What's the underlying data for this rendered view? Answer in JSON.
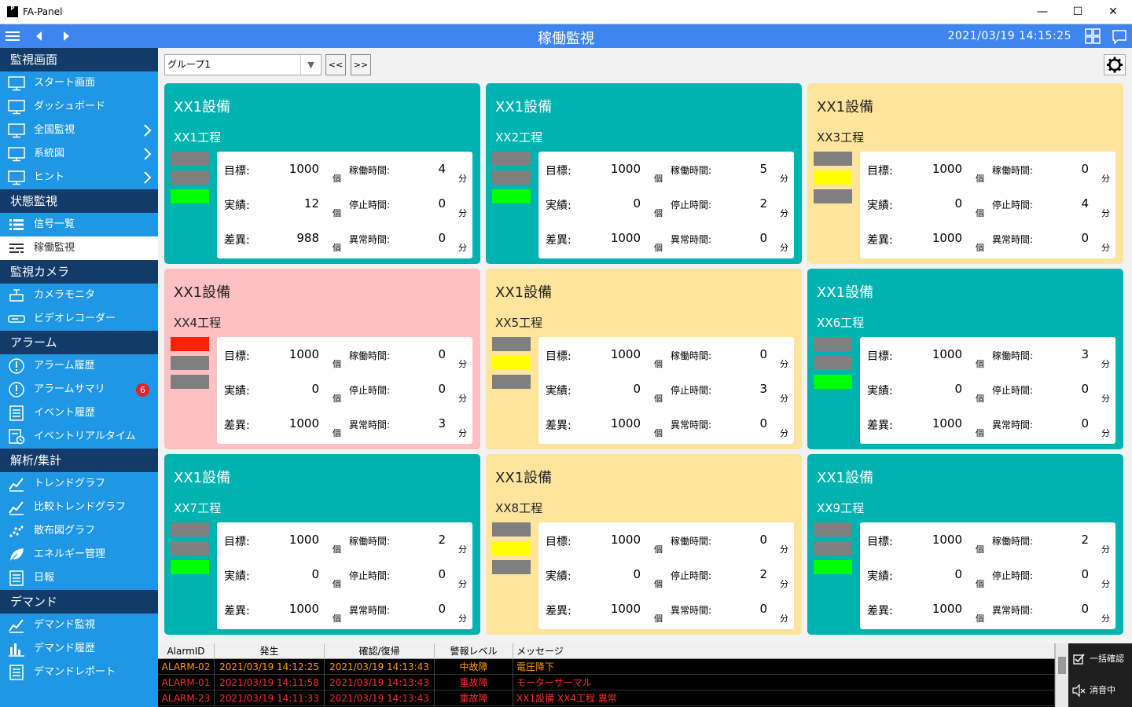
{
  "window": {
    "icon_text": "P",
    "title": "FA-Panel",
    "minimize": "—",
    "maximize": "☐",
    "close": "✕"
  },
  "header": {
    "title": "稼働監視",
    "datetime": "2021/03/19 14:15:25"
  },
  "sidebar": {
    "sections": [
      {
        "title": "監視画面",
        "items": [
          {
            "label": "スタート画面",
            "icon": "monitor-icon"
          },
          {
            "label": "ダッシュボード",
            "icon": "monitor-icon"
          },
          {
            "label": "全国監視",
            "icon": "monitor-icon",
            "chevron": true
          },
          {
            "label": "系統図",
            "icon": "monitor-icon",
            "chevron": true
          },
          {
            "label": "ヒント",
            "icon": "monitor-icon",
            "chevron": true
          }
        ]
      },
      {
        "title": "状態監視",
        "items": [
          {
            "label": "信号一覧",
            "icon": "list-icon"
          },
          {
            "label": "稼働監視",
            "icon": "gantt-icon",
            "active": true
          }
        ]
      },
      {
        "title": "監視カメラ",
        "items": [
          {
            "label": "カメラモニタ",
            "icon": "camera-icon"
          },
          {
            "label": "ビデオレコーダー",
            "icon": "recorder-icon"
          }
        ]
      },
      {
        "title": "アラーム",
        "items": [
          {
            "label": "アラーム履歴",
            "icon": "alert-icon"
          },
          {
            "label": "アラームサマリ",
            "icon": "alert-icon",
            "badge": "6"
          },
          {
            "label": "イベント履歴",
            "icon": "document-icon"
          },
          {
            "label": "イベントリアルタイム",
            "icon": "realtime-icon"
          }
        ]
      },
      {
        "title": "解析/集計",
        "items": [
          {
            "label": "トレンドグラフ",
            "icon": "trend-icon"
          },
          {
            "label": "比較トレンドグラフ",
            "icon": "trend-icon"
          },
          {
            "label": "散布図グラフ",
            "icon": "scatter-icon"
          },
          {
            "label": "エネルギー管理",
            "icon": "leaf-icon"
          },
          {
            "label": "日報",
            "icon": "document-icon"
          }
        ]
      },
      {
        "title": "デマンド",
        "items": [
          {
            "label": "デマンド監視",
            "icon": "trend-icon"
          },
          {
            "label": "デマンド履歴",
            "icon": "bars-icon"
          },
          {
            "label": "デマンドレポート",
            "icon": "document-icon"
          }
        ]
      }
    ]
  },
  "toolbar": {
    "group_value": "グループ1",
    "dropdown_arrow": "▼",
    "prev_label": "<<",
    "next_label": ">>"
  },
  "labels": {
    "target": "目標:",
    "actual": "実績:",
    "diff": "差異:",
    "run_time": "稼働時間:",
    "stop_time": "停止時間:",
    "error_time": "異常時間:",
    "unit_pcs": "個",
    "unit_min": "分"
  },
  "colors": {
    "green_card": "#00b2b0",
    "yellow_card": "#ffe49e",
    "red_card": "#fec0c2",
    "header_blue": "#3f85ef",
    "sidebar_blue": "#1f97e4",
    "sidebar_section": "#123b6a"
  },
  "cards": [
    {
      "equipment": "XX1設備",
      "process": "XX1工程",
      "state": "green",
      "lamps": [
        "gray",
        "gray",
        "green"
      ],
      "target": "1000",
      "actual": "12",
      "diff": "988",
      "run": "4",
      "stop": "0",
      "error": "0"
    },
    {
      "equipment": "XX1設備",
      "process": "XX2工程",
      "state": "green",
      "lamps": [
        "gray",
        "gray",
        "green"
      ],
      "target": "1000",
      "actual": "0",
      "diff": "1000",
      "run": "5",
      "stop": "2",
      "error": "0"
    },
    {
      "equipment": "XX1設備",
      "process": "XX3工程",
      "state": "yellow",
      "lamps": [
        "gray",
        "yellow",
        "gray"
      ],
      "target": "1000",
      "actual": "0",
      "diff": "1000",
      "run": "0",
      "stop": "4",
      "error": "0"
    },
    {
      "equipment": "XX1設備",
      "process": "XX4工程",
      "state": "red",
      "lamps": [
        "red",
        "gray",
        "gray"
      ],
      "target": "1000",
      "actual": "0",
      "diff": "1000",
      "run": "0",
      "stop": "0",
      "error": "3"
    },
    {
      "equipment": "XX1設備",
      "process": "XX5工程",
      "state": "yellow",
      "lamps": [
        "gray",
        "yellow",
        "gray"
      ],
      "target": "1000",
      "actual": "0",
      "diff": "1000",
      "run": "0",
      "stop": "3",
      "error": "0"
    },
    {
      "equipment": "XX1設備",
      "process": "XX6工程",
      "state": "green",
      "lamps": [
        "gray",
        "gray",
        "green"
      ],
      "target": "1000",
      "actual": "0",
      "diff": "1000",
      "run": "3",
      "stop": "0",
      "error": "0"
    },
    {
      "equipment": "XX1設備",
      "process": "XX7工程",
      "state": "green",
      "lamps": [
        "gray",
        "gray",
        "green"
      ],
      "target": "1000",
      "actual": "0",
      "diff": "1000",
      "run": "2",
      "stop": "0",
      "error": "0"
    },
    {
      "equipment": "XX1設備",
      "process": "XX8工程",
      "state": "yellow",
      "lamps": [
        "gray",
        "yellow",
        "gray"
      ],
      "target": "1000",
      "actual": "0",
      "diff": "1000",
      "run": "0",
      "stop": "2",
      "error": "0"
    },
    {
      "equipment": "XX1設備",
      "process": "XX9工程",
      "state": "green",
      "lamps": [
        "gray",
        "gray",
        "green"
      ],
      "target": "1000",
      "actual": "0",
      "diff": "1000",
      "run": "2",
      "stop": "0",
      "error": "0"
    }
  ],
  "alarms": {
    "columns": [
      "AlarmID",
      "発生",
      "確認/復帰",
      "警報レベル",
      "メッセージ"
    ],
    "rows": [
      {
        "id": "ALARM-02",
        "occurred": "2021/03/19 14:12:25",
        "confirmed": "2021/03/19 14:13:43",
        "level": "中故障",
        "message": "電圧降下",
        "color": "#ff9900"
      },
      {
        "id": "ALARM-01",
        "occurred": "2021/03/19 14:11:58",
        "confirmed": "2021/03/19 14:13:43",
        "level": "重故障",
        "message": "モーターサーマル",
        "color": "#ff2a2a"
      },
      {
        "id": "ALARM-23",
        "occurred": "2021/03/19 14:11:33",
        "confirmed": "2021/03/19 14:13:43",
        "level": "重故障",
        "message": "XX1設備 XX4工程 異常",
        "color": "#ff2a2a"
      }
    ],
    "confirm_all": "一括確認",
    "mute": "消音中"
  }
}
